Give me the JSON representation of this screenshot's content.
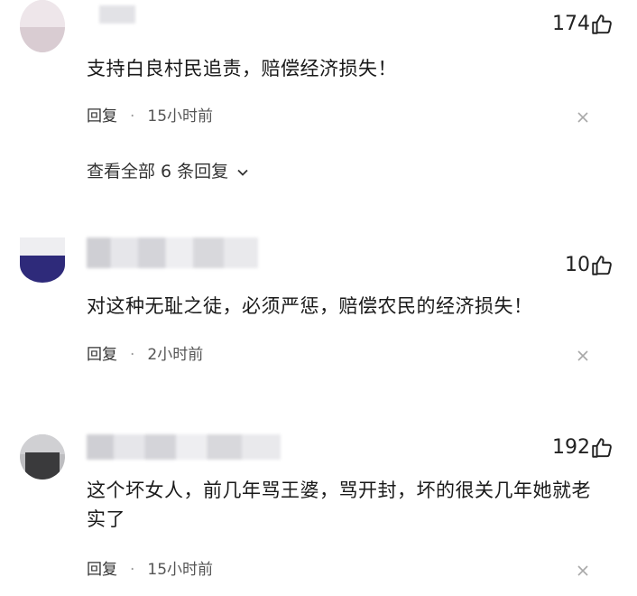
{
  "comments": [
    {
      "likes": "174",
      "text": "支持白良村民追责，赔偿经济损失！",
      "reply_label": "回复",
      "dot": "·",
      "time": "15小时前",
      "view_replies": "查看全部 6 条回复"
    },
    {
      "likes": "10",
      "text": "对这种无耻之徒，必须严惩，赔偿农民的经济损失！",
      "reply_label": "回复",
      "dot": "·",
      "time": "2小时前"
    },
    {
      "likes": "192",
      "text": "这个坏女人，前几年骂王婆，骂开封，坏的很关几年她就老实了",
      "reply_label": "回复",
      "dot": "·",
      "time": "15小时前"
    }
  ],
  "icons": {
    "like": "thumbs-up-icon",
    "close": "close-icon",
    "chevron": "chevron-down-icon"
  },
  "colors": {
    "text": "#1a1a1a",
    "meta": "#5a5a5a",
    "avatar2_accent": "#2e2a7a"
  }
}
